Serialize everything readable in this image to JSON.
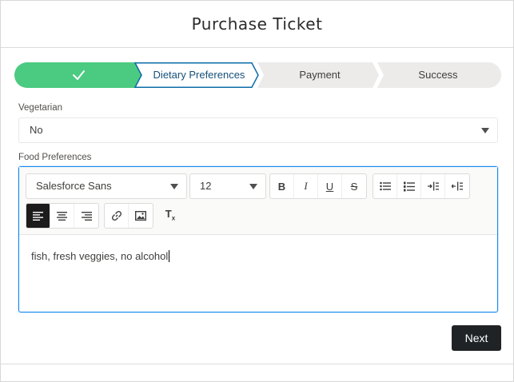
{
  "modal": {
    "title": "Purchase Ticket"
  },
  "path": {
    "steps": [
      {
        "label": "",
        "state": "complete",
        "icon": "check-icon"
      },
      {
        "label": "Dietary Preferences",
        "state": "current"
      },
      {
        "label": "Payment",
        "state": "incomplete"
      },
      {
        "label": "Success",
        "state": "incomplete"
      }
    ],
    "colors": {
      "complete": "#4bca81",
      "current_border": "#0070d2",
      "incomplete": "#ecebea"
    }
  },
  "vegetarian": {
    "label": "Vegetarian",
    "value": "No"
  },
  "food_preferences": {
    "label": "Food Preferences",
    "toolbar": {
      "font_family": "Salesforce Sans",
      "font_size": "12",
      "format_buttons": [
        "bold",
        "italic",
        "underline",
        "strikethrough"
      ],
      "list_buttons": [
        "bulleted-list",
        "numbered-list",
        "indent",
        "outdent"
      ],
      "align_buttons": [
        "align-left",
        "align-center",
        "align-right"
      ],
      "insert_buttons": [
        "link",
        "image"
      ],
      "clear_button": "clear-formatting"
    },
    "content": "fish, fresh veggies, no alcohol"
  },
  "footer": {
    "next_label": "Next"
  }
}
